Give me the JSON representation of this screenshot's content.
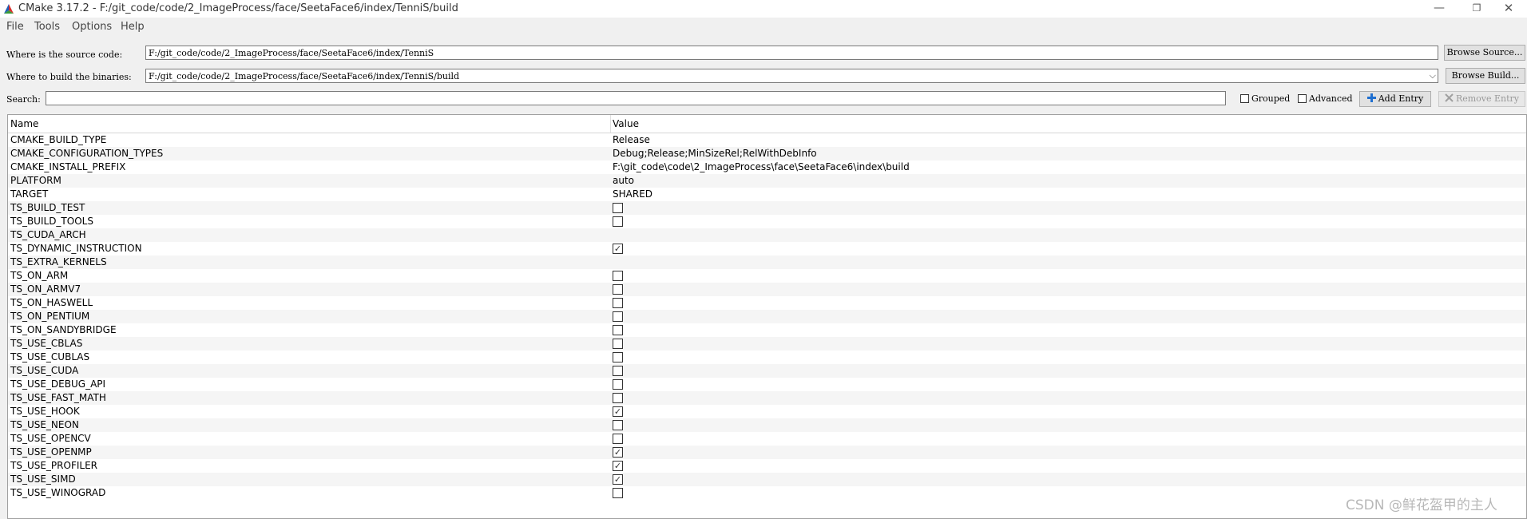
{
  "window": {
    "title": "CMake 3.17.2 - F:/git_code/code/2_ImageProcess/face/SeetaFace6/index/TenniS/build",
    "minimize_glyph": "—",
    "maximize_glyph": "❐",
    "close_glyph": "✕"
  },
  "menu": {
    "items": [
      "File",
      "Tools",
      "Options",
      "Help"
    ]
  },
  "source": {
    "label": "Where is the source code:",
    "value": "F:/git_code/code/2_ImageProcess/face/SeetaFace6/index/TenniS",
    "browse_label": "Browse Source..."
  },
  "build": {
    "label": "Where to build the binaries:",
    "value": "F:/git_code/code/2_ImageProcess/face/SeetaFace6/index/TenniS/build",
    "browse_label": "Browse Build...",
    "dropdown_glyph": "⌵"
  },
  "search": {
    "label": "Search:",
    "value": "",
    "grouped_label": "Grouped",
    "advanced_label": "Advanced",
    "add_entry_label": "Add Entry",
    "remove_entry_label": "Remove Entry"
  },
  "table": {
    "headers": {
      "name": "Name",
      "value": "Value"
    },
    "check_glyph": "✓",
    "rows": [
      {
        "name": "CMAKE_BUILD_TYPE",
        "type": "text",
        "value": "Release"
      },
      {
        "name": "CMAKE_CONFIGURATION_TYPES",
        "type": "text",
        "value": "Debug;Release;MinSizeRel;RelWithDebInfo"
      },
      {
        "name": "CMAKE_INSTALL_PREFIX",
        "type": "text",
        "value": "F:\\git_code\\code\\2_ImageProcess\\face\\SeetaFace6\\index\\build"
      },
      {
        "name": "PLATFORM",
        "type": "text",
        "value": "auto"
      },
      {
        "name": "TARGET",
        "type": "text",
        "value": "SHARED"
      },
      {
        "name": "TS_BUILD_TEST",
        "type": "bool",
        "checked": false
      },
      {
        "name": "TS_BUILD_TOOLS",
        "type": "bool",
        "checked": false
      },
      {
        "name": "TS_CUDA_ARCH",
        "type": "text",
        "value": ""
      },
      {
        "name": "TS_DYNAMIC_INSTRUCTION",
        "type": "bool",
        "checked": true
      },
      {
        "name": "TS_EXTRA_KERNELS",
        "type": "text",
        "value": ""
      },
      {
        "name": "TS_ON_ARM",
        "type": "bool",
        "checked": false
      },
      {
        "name": "TS_ON_ARMV7",
        "type": "bool",
        "checked": false
      },
      {
        "name": "TS_ON_HASWELL",
        "type": "bool",
        "checked": false
      },
      {
        "name": "TS_ON_PENTIUM",
        "type": "bool",
        "checked": false
      },
      {
        "name": "TS_ON_SANDYBRIDGE",
        "type": "bool",
        "checked": false
      },
      {
        "name": "TS_USE_CBLAS",
        "type": "bool",
        "checked": false
      },
      {
        "name": "TS_USE_CUBLAS",
        "type": "bool",
        "checked": false
      },
      {
        "name": "TS_USE_CUDA",
        "type": "bool",
        "checked": false
      },
      {
        "name": "TS_USE_DEBUG_API",
        "type": "bool",
        "checked": false
      },
      {
        "name": "TS_USE_FAST_MATH",
        "type": "bool",
        "checked": false
      },
      {
        "name": "TS_USE_HOOK",
        "type": "bool",
        "checked": true
      },
      {
        "name": "TS_USE_NEON",
        "type": "bool",
        "checked": false
      },
      {
        "name": "TS_USE_OPENCV",
        "type": "bool",
        "checked": false
      },
      {
        "name": "TS_USE_OPENMP",
        "type": "bool",
        "checked": true
      },
      {
        "name": "TS_USE_PROFILER",
        "type": "bool",
        "checked": true
      },
      {
        "name": "TS_USE_SIMD",
        "type": "bool",
        "checked": true
      },
      {
        "name": "TS_USE_WINOGRAD",
        "type": "bool",
        "checked": false
      }
    ]
  },
  "watermark": "CSDN @鲜花盔甲的主人",
  "colors": {
    "logo_red": "#d9302c",
    "logo_green": "#3a9b3a",
    "logo_blue": "#1f5fb8",
    "add_icon_blue": "#1f6fd0"
  }
}
